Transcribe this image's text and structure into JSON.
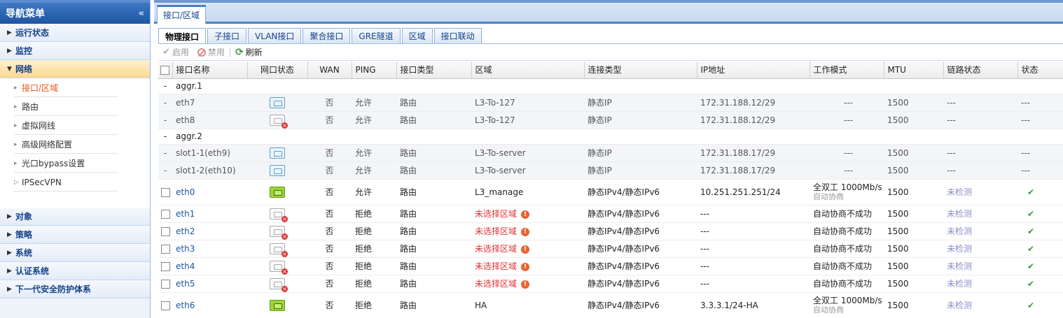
{
  "sidebar": {
    "title": "导航菜单",
    "collapse_glyph": "«",
    "groups_top": [
      {
        "label": "运行状态"
      },
      {
        "label": "监控"
      }
    ],
    "network": {
      "label": "网络",
      "items": [
        {
          "label": "接口/区域",
          "active": true
        },
        {
          "label": "路由"
        },
        {
          "label": "虚拟网线"
        },
        {
          "label": "高级网络配置"
        },
        {
          "label": "光口bypass设置"
        },
        {
          "label": "IPSecVPN"
        }
      ]
    },
    "groups_bottom": [
      {
        "label": "对象"
      },
      {
        "label": "策略"
      },
      {
        "label": "系统"
      },
      {
        "label": "认证系统"
      },
      {
        "label": "下一代安全防护体系"
      }
    ]
  },
  "top_tab": {
    "label": "接口/区域"
  },
  "sub_tabs": [
    "物理接口",
    "子接口",
    "VLAN接口",
    "聚合接口",
    "GRE隧道",
    "区域",
    "接口联动"
  ],
  "toolbar": {
    "enable": "启用",
    "disable": "禁用",
    "refresh": "刷新"
  },
  "columns": [
    "接口名称",
    "网口状态",
    "WAN",
    "PING",
    "接口类型",
    "区域",
    "连接类型",
    "IP地址",
    "工作模式",
    "MTU",
    "链路状态",
    "状态"
  ],
  "groups": [
    {
      "name": "aggr.1",
      "rows": [
        {
          "name": "eth7",
          "port": "up",
          "wan": "否",
          "ping": "允许",
          "type": "路由",
          "zone": "L3-To-127",
          "conn": "静态IP",
          "ip": "172.31.188.12/29",
          "mode": "---",
          "mtu": "1500",
          "link": "---",
          "status": "---"
        },
        {
          "name": "eth8",
          "port": "down",
          "wan": "否",
          "ping": "允许",
          "type": "路由",
          "zone": "L3-To-127",
          "conn": "静态IP",
          "ip": "172.31.188.12/29",
          "mode": "---",
          "mtu": "1500",
          "link": "---",
          "status": "---"
        }
      ]
    },
    {
      "name": "aggr.2",
      "rows": [
        {
          "name": "slot1-1(eth9)",
          "port": "up",
          "wan": "否",
          "ping": "允许",
          "type": "路由",
          "zone": "L3-To-server",
          "conn": "静态IP",
          "ip": "172.31.188.17/29",
          "mode": "---",
          "mtu": "1500",
          "link": "---",
          "status": "---"
        },
        {
          "name": "slot1-2(eth10)",
          "port": "up",
          "wan": "否",
          "ping": "允许",
          "type": "路由",
          "zone": "L3-To-server",
          "conn": "静态IP",
          "ip": "172.31.188.17/29",
          "mode": "---",
          "mtu": "1500",
          "link": "---",
          "status": "---"
        }
      ]
    }
  ],
  "rows": [
    {
      "name": "eth0",
      "port": "active",
      "wan": "否",
      "ping": "允许",
      "type": "路由",
      "zone": "L3_manage",
      "zone_warn": false,
      "conn": "静态IPv4/静态IPv6",
      "ip": "10.251.251.251/24",
      "mode": "全双工 1000Mb/s",
      "mode2": "自动协商",
      "mtu": "1500",
      "link": "未检测",
      "status": "✔"
    },
    {
      "name": "eth1",
      "port": "down",
      "wan": "否",
      "ping": "拒绝",
      "type": "路由",
      "zone": "未选择区域",
      "zone_warn": true,
      "conn": "静态IPv4/静态IPv6",
      "ip": "---",
      "mode": "自动协商不成功",
      "mode2": "",
      "mtu": "1500",
      "link": "未检测",
      "status": "✔"
    },
    {
      "name": "eth2",
      "port": "down",
      "wan": "否",
      "ping": "拒绝",
      "type": "路由",
      "zone": "未选择区域",
      "zone_warn": true,
      "conn": "静态IPv4/静态IPv6",
      "ip": "---",
      "mode": "自动协商不成功",
      "mode2": "",
      "mtu": "1500",
      "link": "未检测",
      "status": "✔"
    },
    {
      "name": "eth3",
      "port": "down",
      "wan": "否",
      "ping": "拒绝",
      "type": "路由",
      "zone": "未选择区域",
      "zone_warn": true,
      "conn": "静态IPv4/静态IPv6",
      "ip": "---",
      "mode": "自动协商不成功",
      "mode2": "",
      "mtu": "1500",
      "link": "未检测",
      "status": "✔"
    },
    {
      "name": "eth4",
      "port": "down",
      "wan": "否",
      "ping": "拒绝",
      "type": "路由",
      "zone": "未选择区域",
      "zone_warn": true,
      "conn": "静态IPv4/静态IPv6",
      "ip": "---",
      "mode": "自动协商不成功",
      "mode2": "",
      "mtu": "1500",
      "link": "未检测",
      "status": "✔"
    },
    {
      "name": "eth5",
      "port": "down",
      "wan": "否",
      "ping": "拒绝",
      "type": "路由",
      "zone": "未选择区域",
      "zone_warn": true,
      "conn": "静态IPv4/静态IPv6",
      "ip": "---",
      "mode": "自动协商不成功",
      "mode2": "",
      "mtu": "1500",
      "link": "未检测",
      "status": "✔"
    },
    {
      "name": "eth6",
      "port": "active",
      "wan": "否",
      "ping": "拒绝",
      "type": "路由",
      "zone": "HA",
      "zone_warn": false,
      "conn": "静态IPv4/静态IPv6",
      "ip": "3.3.3.1/24-HA",
      "mode": "全双工 1000Mb/s",
      "mode2": "自动协商",
      "mtu": "1500",
      "link": "未检测",
      "status": "✔"
    }
  ],
  "group_dash": "-",
  "colors": {
    "accent": "#1f56a0",
    "warn": "#dd3333",
    "ok": "#3b9a3b"
  }
}
